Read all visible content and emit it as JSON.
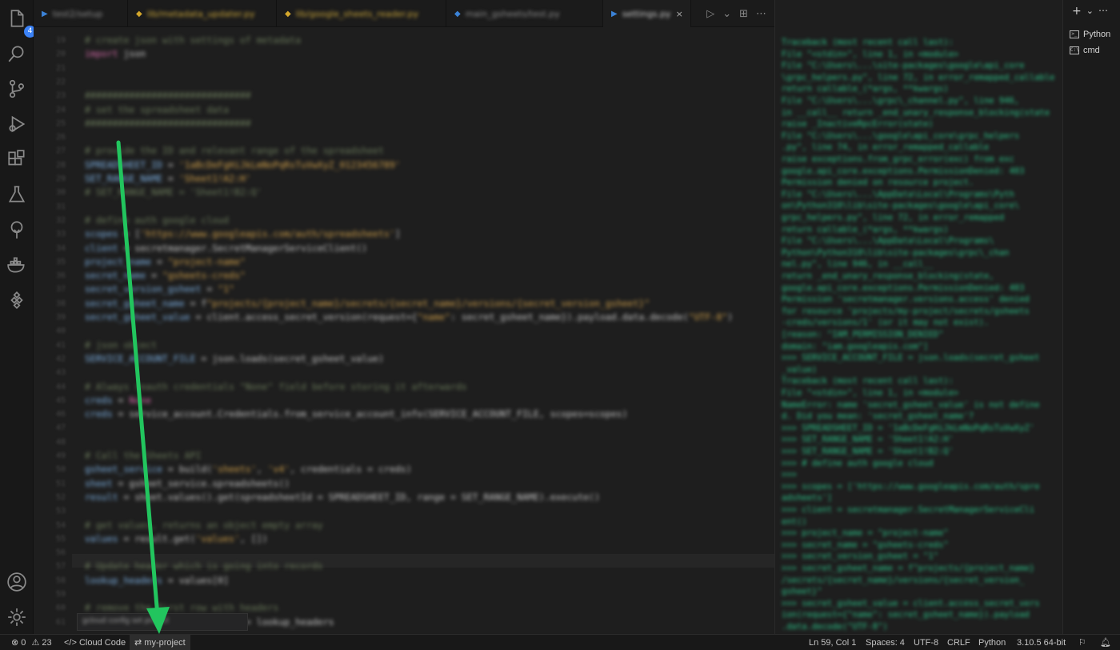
{
  "activity_bar": {
    "explorer_badge": "4"
  },
  "tabs": [
    {
      "label": "test2/setup",
      "color": "blue",
      "active": false
    },
    {
      "label": "lib/metadata_updater.py",
      "color": "yellow",
      "active": false
    },
    {
      "label": "lib/google_sheets_reader.py",
      "color": "yellow",
      "active": false
    },
    {
      "label": "main_gsheets/test.py",
      "color": "blue",
      "active": false
    },
    {
      "label": "settings.py",
      "color": "blue",
      "active": true
    }
  ],
  "terminal_list": {
    "items": [
      {
        "label": "Python",
        "icon": "terminal-icon"
      },
      {
        "label": "cmd",
        "icon": "terminal-icon"
      }
    ]
  },
  "status_bar": {
    "errors": "0",
    "warnings": "23",
    "cloud_code": "Cloud Code",
    "project": "my-project",
    "position": "Ln 59, Col 1",
    "spaces": "Spaces: 4",
    "encoding": "UTF-8",
    "eol": "CRLF",
    "language": "Python",
    "interpreter": "3.10.5 64-bit"
  },
  "annotation": {
    "arrow_color": "#22c55e"
  }
}
